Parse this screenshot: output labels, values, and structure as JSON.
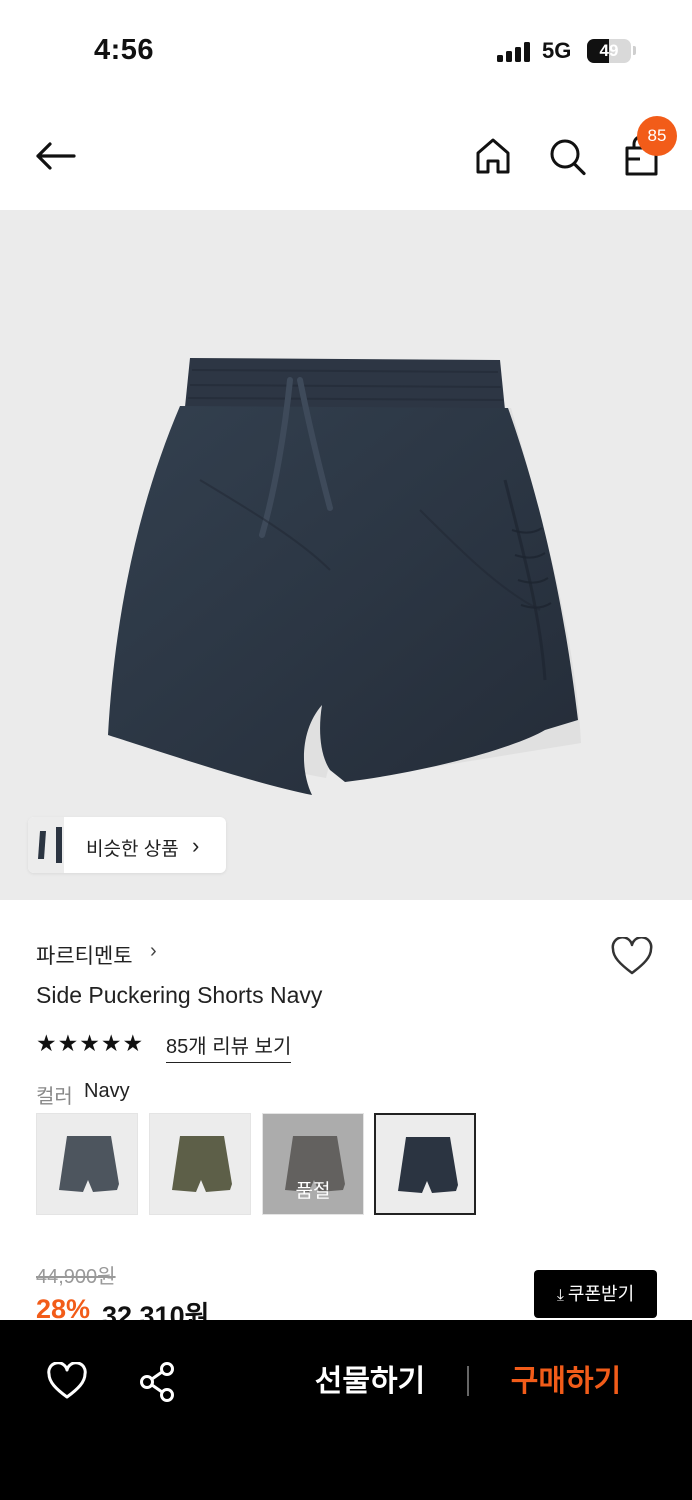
{
  "status_bar": {
    "time": "4:56",
    "network": "5G",
    "battery": "49",
    "battery_level": 0.49
  },
  "header": {
    "back_icon": "arrow-left-icon",
    "home_icon": "home-icon",
    "search_icon": "search-icon",
    "bag_icon": "shopping-bag-icon",
    "cart_count": "85"
  },
  "gallery": {
    "similar_label": "비슷한 상품",
    "similar_chevron": "›"
  },
  "product": {
    "brand": "파르티멘토",
    "brand_chevron": "›",
    "title": "Side Puckering Shorts Navy",
    "rating": 5,
    "stars": "★★★★★",
    "review_link": "85개 리뷰 보기",
    "color_label": "컬러",
    "color_value": "Navy",
    "swatches": [
      {
        "color": "#4d555e",
        "sold_out": false,
        "selected": false
      },
      {
        "color": "#5d5f48",
        "sold_out": false,
        "selected": false
      },
      {
        "color": "#4a4642",
        "sold_out": true,
        "selected": false,
        "sold_out_label": "품절"
      },
      {
        "color": "#2b3441",
        "sold_out": false,
        "selected": true
      }
    ]
  },
  "price": {
    "original": "44,900원",
    "discount": "28%",
    "sale": "32,310원",
    "coupon_label": "쿠폰받기",
    "coupon_icon": "download-icon"
  },
  "bottom_bar": {
    "wishlist_icon": "heart-icon",
    "share_icon": "share-icon",
    "gift_label": "선물하기",
    "buy_label": "구매하기"
  },
  "colors": {
    "accent": "#f25c19",
    "product_navy": "#2b3441",
    "bar_bg": "#000000"
  }
}
